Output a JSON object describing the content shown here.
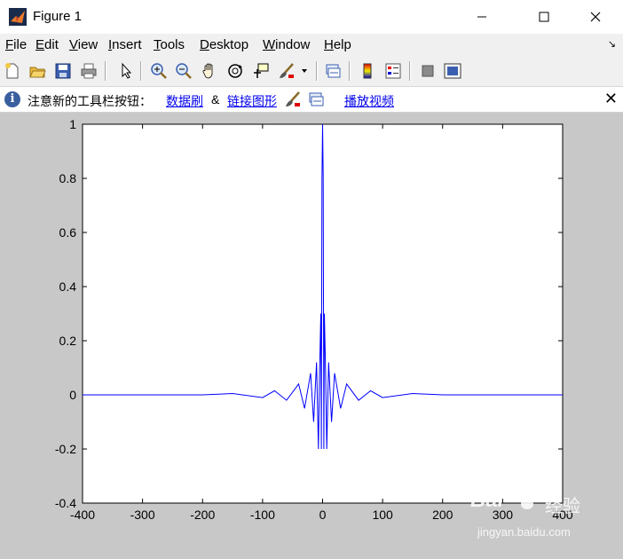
{
  "window": {
    "title": "Figure 1"
  },
  "menu": {
    "items": [
      {
        "mnemonic": "F",
        "rest": "ile"
      },
      {
        "mnemonic": "E",
        "rest": "dit"
      },
      {
        "mnemonic": "V",
        "rest": "iew"
      },
      {
        "mnemonic": "I",
        "rest": "nsert"
      },
      {
        "mnemonic": "T",
        "rest": "ools"
      },
      {
        "mnemonic": "D",
        "rest": "esktop"
      },
      {
        "mnemonic": "W",
        "rest": "indow"
      },
      {
        "mnemonic": "H",
        "rest": "elp"
      }
    ],
    "overflow_arrow": "↘"
  },
  "toolbar": {
    "icons": [
      "new-figure-icon",
      "open-file-icon",
      "save-icon",
      "print-icon",
      "pointer-icon",
      "zoom-in-icon",
      "zoom-out-icon",
      "pan-hand-icon",
      "rotate-3d-icon",
      "data-cursor-icon",
      "brush-icon",
      "brush-dropdown-icon",
      "link-plot-icon",
      "colorbar-icon",
      "legend-icon",
      "hide-plot-tools-icon",
      "show-plot-tools-icon"
    ]
  },
  "infobar": {
    "message": "注意新的工具栏按钮：",
    "link_data_brush": "数据刷",
    "ampersand": "&",
    "link_linked_plots": "链接图形",
    "link_play_video": "播放视频",
    "close": "✕"
  },
  "chart_data": {
    "type": "line",
    "title": "",
    "xlabel": "",
    "ylabel": "",
    "xlim": [
      -400,
      400
    ],
    "ylim": [
      -0.4,
      1
    ],
    "xticks": [
      -400,
      -300,
      -200,
      -100,
      0,
      100,
      200,
      300,
      400
    ],
    "yticks": [
      -0.4,
      -0.2,
      0,
      0.2,
      0.4,
      0.6,
      0.8,
      1
    ],
    "xtick_labels": [
      "-400",
      "-300",
      "-200",
      "-100",
      "0",
      "100",
      "200",
      "300",
      "400"
    ],
    "ytick_labels": [
      "-0.4",
      "-0.2",
      "0",
      "0.2",
      "0.4",
      "0.6",
      "0.8",
      "1"
    ],
    "grid": false,
    "series": [
      {
        "color": "#0000ff",
        "x": [
          -400,
          -300,
          -200,
          -150,
          -100,
          -80,
          -60,
          -40,
          -30,
          -20,
          -15,
          -10,
          -7,
          -5,
          -3,
          -2,
          -1,
          0,
          1,
          2,
          3,
          5,
          7,
          10,
          15,
          20,
          30,
          40,
          60,
          80,
          100,
          150,
          200,
          300,
          400
        ],
        "y": [
          0,
          0,
          0,
          0.005,
          -0.01,
          0.015,
          -0.02,
          0.04,
          -0.05,
          0.08,
          -0.1,
          0.12,
          -0.2,
          0.08,
          0.3,
          -0.2,
          0.8,
          1,
          0.8,
          -0.2,
          0.3,
          0.08,
          -0.2,
          0.12,
          -0.1,
          0.08,
          -0.05,
          0.04,
          -0.02,
          0.015,
          -0.01,
          0.005,
          0,
          0,
          0
        ]
      }
    ]
  },
  "watermark": {
    "brand": "Bai",
    "brand2": "经验",
    "url": "jingyan.baidu.com"
  }
}
